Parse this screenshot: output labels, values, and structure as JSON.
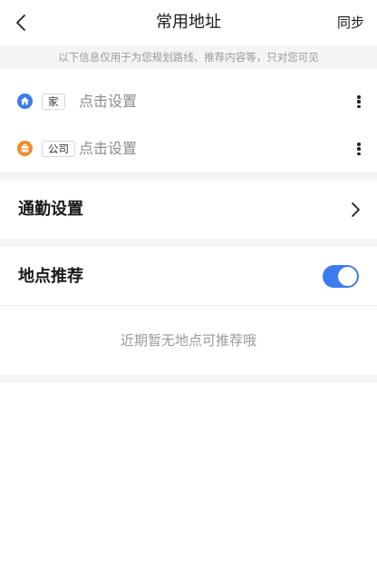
{
  "header": {
    "title": "常用地址",
    "sync_label": "同步"
  },
  "notice": "以下信息仅用于为您规划路线、推荐内容等，只对您可见",
  "addresses": [
    {
      "tag": "家",
      "action": "点击设置",
      "icon": "home-icon",
      "icon_color": "#3b7cf0"
    },
    {
      "tag": "公司",
      "action": "点击设置",
      "icon": "briefcase-icon",
      "icon_color": "#f08a2c"
    }
  ],
  "commute": {
    "label": "通勤设置"
  },
  "recommend": {
    "label": "地点推荐",
    "enabled": true,
    "empty_text": "近期暂无地点可推荐哦"
  },
  "colors": {
    "accent": "#3d7bf0",
    "separator": "#f3f4f6",
    "muted_text": "#9a9a9a"
  }
}
